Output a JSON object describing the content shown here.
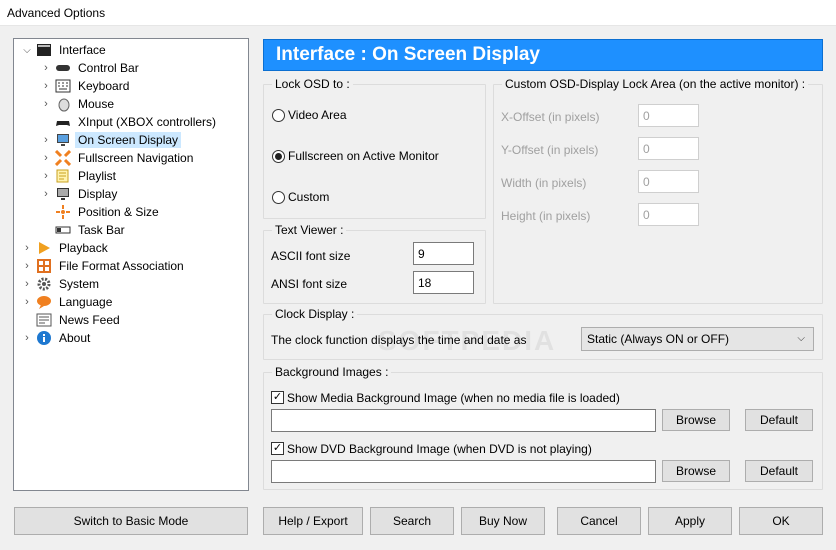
{
  "window": {
    "title": "Advanced Options"
  },
  "tree": {
    "items": [
      {
        "label": "Interface",
        "icon": "interface-icon",
        "level": 0,
        "expander": "open"
      },
      {
        "label": "Control Bar",
        "icon": "control-bar-icon",
        "level": 1,
        "expander": "closed"
      },
      {
        "label": "Keyboard",
        "icon": "keyboard-icon",
        "level": 1,
        "expander": "closed"
      },
      {
        "label": "Mouse",
        "icon": "mouse-icon",
        "level": 1,
        "expander": "closed"
      },
      {
        "label": "XInput (XBOX controllers)",
        "icon": "gamepad-icon",
        "level": 1,
        "expander": "none"
      },
      {
        "label": "On Screen Display",
        "icon": "osd-icon",
        "level": 1,
        "expander": "closed",
        "selected": true
      },
      {
        "label": "Fullscreen Navigation",
        "icon": "fullscreen-icon",
        "level": 1,
        "expander": "closed"
      },
      {
        "label": "Playlist",
        "icon": "playlist-icon",
        "level": 1,
        "expander": "closed"
      },
      {
        "label": "Display",
        "icon": "display-icon",
        "level": 1,
        "expander": "closed"
      },
      {
        "label": "Position & Size",
        "icon": "position-icon",
        "level": 1,
        "expander": "none"
      },
      {
        "label": "Task Bar",
        "icon": "taskbar-icon",
        "level": 1,
        "expander": "none"
      },
      {
        "label": "Playback",
        "icon": "playback-icon",
        "level": 0,
        "expander": "closed"
      },
      {
        "label": "File Format Association",
        "icon": "file-format-icon",
        "level": 0,
        "expander": "closed"
      },
      {
        "label": "System",
        "icon": "gear-icon",
        "level": 0,
        "expander": "closed"
      },
      {
        "label": "Language",
        "icon": "language-icon",
        "level": 0,
        "expander": "closed"
      },
      {
        "label": "News Feed",
        "icon": "news-icon",
        "level": 0,
        "expander": "none"
      },
      {
        "label": "About",
        "icon": "info-icon",
        "level": 0,
        "expander": "closed"
      }
    ]
  },
  "panel": {
    "header": "Interface : On Screen Display",
    "lock_osd": {
      "title": "Lock OSD to :",
      "options": [
        {
          "label": "Video Area",
          "checked": false
        },
        {
          "label": "Fullscreen on Active Monitor",
          "checked": true
        },
        {
          "label": "Custom",
          "checked": false
        }
      ]
    },
    "custom_area": {
      "title": "Custom OSD-Display Lock Area (on the active monitor) :",
      "fields": [
        {
          "label": "X-Offset (in pixels)",
          "value": "0"
        },
        {
          "label": "Y-Offset (in pixels)",
          "value": "0"
        },
        {
          "label": "Width (in pixels)",
          "value": "0"
        },
        {
          "label": "Height (in pixels)",
          "value": "0"
        }
      ]
    },
    "text_viewer": {
      "title": "Text Viewer :",
      "ascii_label": "ASCII font size",
      "ascii_value": "9",
      "ansi_label": "ANSI font size",
      "ansi_value": "18"
    },
    "clock": {
      "title": "Clock Display :",
      "label": "The clock function displays the time and date as",
      "selected": "Static (Always ON or OFF)"
    },
    "background": {
      "title": "Background Images :",
      "media_label": "Show Media Background Image (when no media file is loaded)",
      "media_checked": true,
      "media_path": "",
      "dvd_label": "Show DVD Background Image (when DVD is not playing)",
      "dvd_checked": true,
      "dvd_path": "",
      "browse_label": "Browse",
      "default_label": "Default"
    }
  },
  "footer": {
    "switch_basic": "Switch to Basic Mode",
    "help_export": "Help / Export",
    "search": "Search",
    "buy_now": "Buy Now",
    "cancel": "Cancel",
    "apply": "Apply",
    "ok": "OK"
  },
  "watermark": "SOFTPEDIA"
}
